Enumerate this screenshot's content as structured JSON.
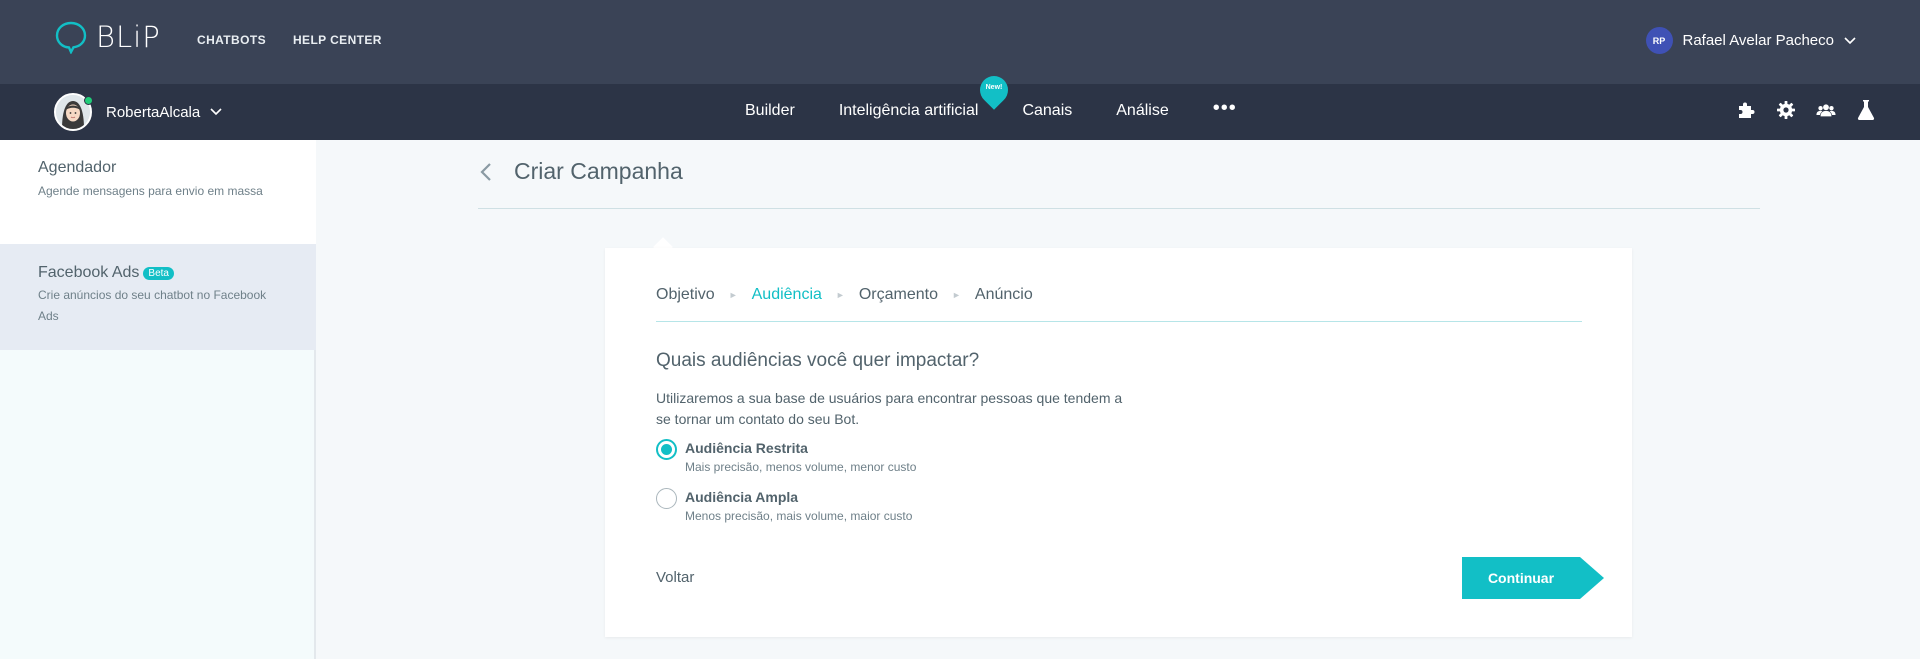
{
  "brand": {
    "name": "BLiP"
  },
  "top_links": [
    "CHATBOTS",
    "HELP CENTER"
  ],
  "user": {
    "initials": "RP",
    "name": "Rafael Avelar Pacheco"
  },
  "bot": {
    "name": "RobertaAlcala"
  },
  "nav": {
    "items": [
      "Builder",
      "Inteligência artificial",
      "Canais",
      "Análise"
    ],
    "new_badge": "New!",
    "more": "•••",
    "icons": [
      "puzzle-icon",
      "gear-icon",
      "team-icon",
      "flask-icon"
    ]
  },
  "sidebar": {
    "items": [
      {
        "title": "Agendador",
        "desc": "Agende mensagens para envio em massa"
      },
      {
        "title": "Facebook Ads",
        "badge": "Beta",
        "desc": "Crie anúncios do seu chatbot no Facebook Ads"
      }
    ]
  },
  "page": {
    "title": "Criar Campanha"
  },
  "wizard": {
    "steps": [
      "Objetivo",
      "Audiência",
      "Orçamento",
      "Anúncio"
    ],
    "active_step": 1,
    "separator": "►",
    "question": "Quais audiências você quer impactar?",
    "intro": "Utilizaremos a sua base de usuários para encontrar pessoas que tendem a se tornar um contato do seu Bot.",
    "options": [
      {
        "title": "Audiência Restrita",
        "desc": "Mais precisão, menos volume, menor custo",
        "selected": true
      },
      {
        "title": "Audiência Ampla",
        "desc": "Menos precisão, mais volume, maior custo",
        "selected": false
      }
    ],
    "back_label": "Voltar",
    "continue_label": "Continuar"
  },
  "colors": {
    "accent": "#12bfc6",
    "topbar": "#3a4356",
    "navbar": "#2c3446"
  }
}
